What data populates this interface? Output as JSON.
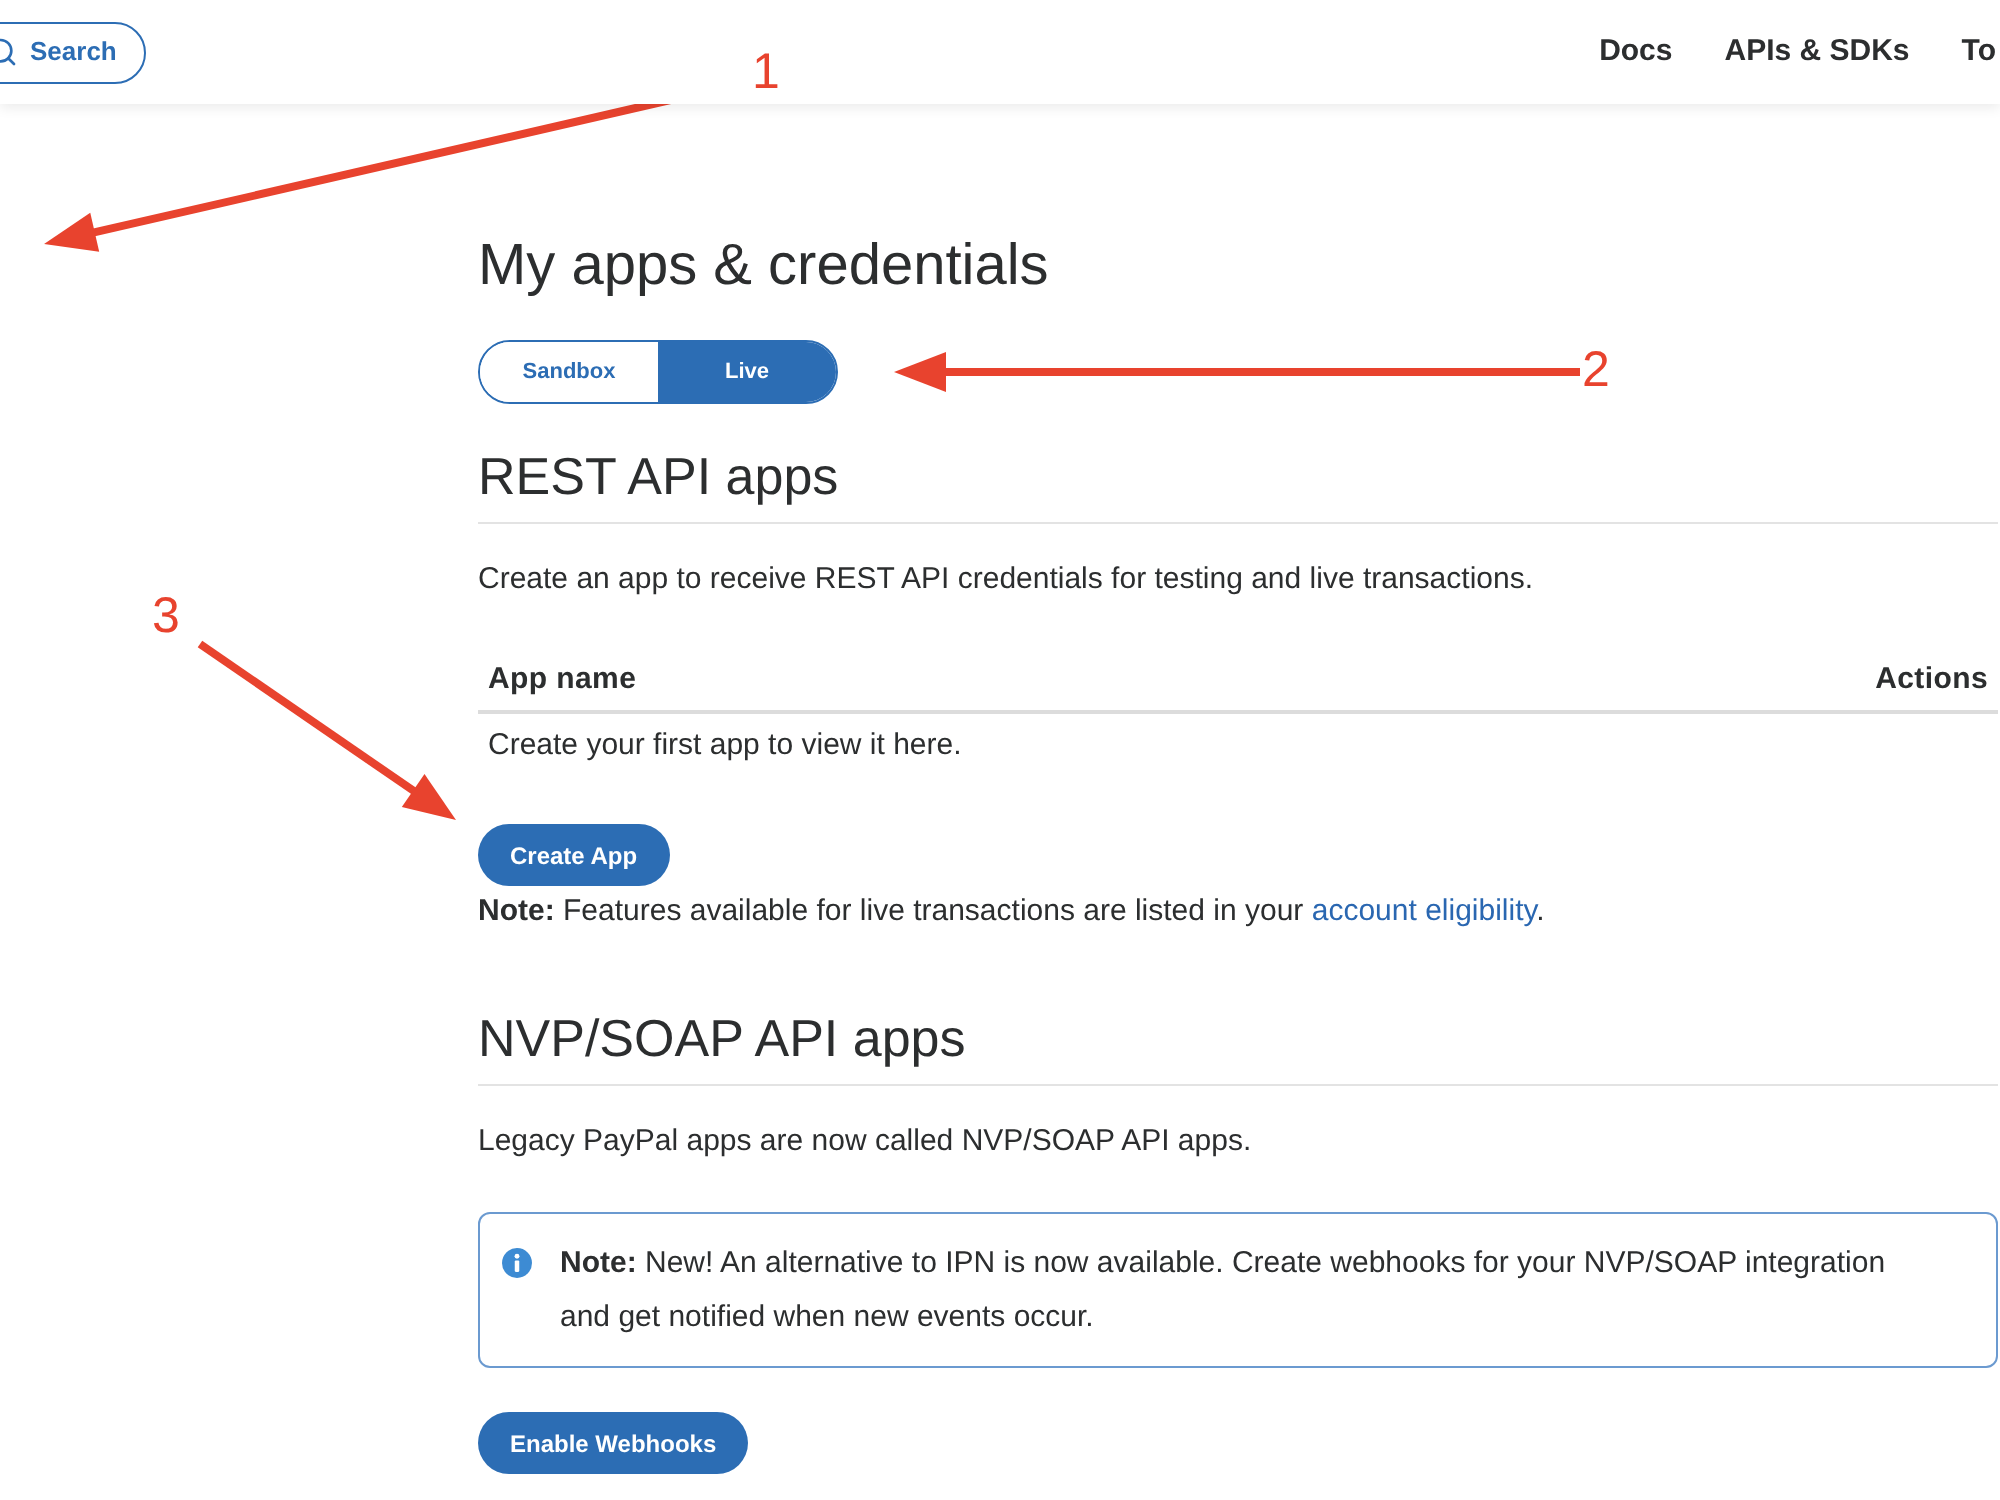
{
  "header": {
    "search_button": "Search",
    "nav": [
      "Docs",
      "APIs & SDKs",
      "To"
    ]
  },
  "title": "My apps & credentials",
  "environment_tabs": [
    {
      "label": "Sandbox",
      "selected": false
    },
    {
      "label": "Live",
      "selected": true
    }
  ],
  "rest_api_apps": {
    "heading": "REST API apps",
    "description": "Create an app to receive REST API credentials for testing and live transactions.",
    "table": {
      "columns": [
        "App name",
        "Actions"
      ],
      "empty_message": "Create your first app to view it here."
    },
    "button": "Create App",
    "note": {
      "text": "**Note:** Features available for live transactions are listed in your",
      "link": "account eligibility",
      "after": "."
    }
  },
  "nvp_soap_api_apps": {
    "heading": "NVP/SOAP API apps",
    "description": "Legacy PayPal apps are now called NVP/SOAP API apps.",
    "info_note": "**Note:** New! An alternative to IPN is now available. Create webhooks for your NVP/SOAP integration and get notified when new events occur.",
    "button": "Enable Webhooks"
  },
  "annotations": [
    "1",
    "2",
    "3"
  ]
}
